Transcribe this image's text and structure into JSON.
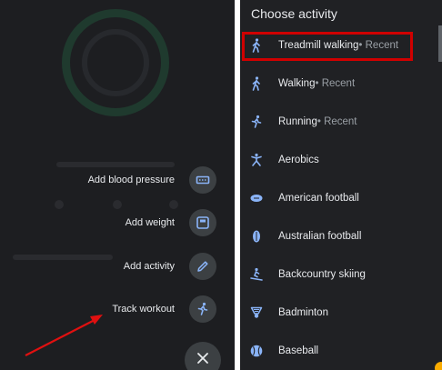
{
  "left": {
    "actions": [
      {
        "label": "Add blood pressure",
        "icon": "blood-pressure-icon"
      },
      {
        "label": "Add weight",
        "icon": "scale-icon"
      },
      {
        "label": "Add activity",
        "icon": "pencil-icon"
      },
      {
        "label": "Track workout",
        "icon": "runner-icon"
      }
    ],
    "close_icon": "close-icon"
  },
  "right": {
    "title": "Choose activity",
    "items": [
      {
        "name": "Treadmill walking",
        "recent": " • Recent",
        "icon": "walking-icon"
      },
      {
        "name": "Walking",
        "recent": " • Recent",
        "icon": "walking-icon"
      },
      {
        "name": "Running",
        "recent": " • Recent",
        "icon": "running-icon"
      },
      {
        "name": "Aerobics",
        "recent": "",
        "icon": "aerobics-icon"
      },
      {
        "name": "American football",
        "recent": "",
        "icon": "american-football-icon"
      },
      {
        "name": "Australian football",
        "recent": "",
        "icon": "australian-football-icon"
      },
      {
        "name": "Backcountry skiing",
        "recent": "",
        "icon": "skiing-icon"
      },
      {
        "name": "Badminton",
        "recent": "",
        "icon": "badminton-icon"
      },
      {
        "name": "Baseball",
        "recent": "",
        "icon": "baseball-icon"
      }
    ]
  },
  "colors": {
    "background": "#202124",
    "text": "#e8eaed",
    "secondary_text": "#9aa0a6",
    "icon_blue": "#8ab4f8",
    "highlight": "#d00000",
    "annotation_arrow": "#e01010"
  }
}
